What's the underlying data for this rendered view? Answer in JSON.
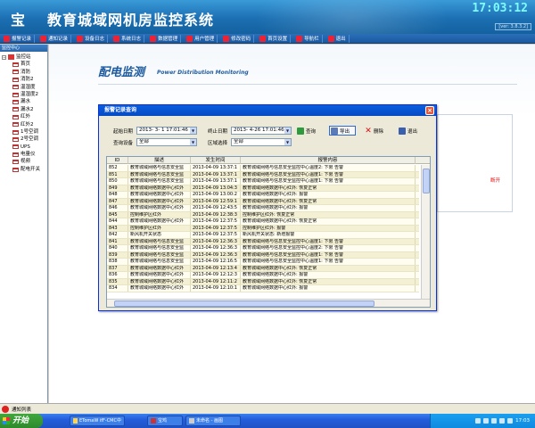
{
  "app": {
    "title_a": "宝",
    "title_b": "教育城域网机房监控系统",
    "clock": "17:03:12",
    "version": "ver: 3.8.3.2"
  },
  "toolbar": [
    {
      "label": "报警记录",
      "icon": "alarm-record-icon"
    },
    {
      "label": "通知记录",
      "icon": "notice-record-icon"
    },
    {
      "label": "设备日志",
      "icon": "device-log-icon"
    },
    {
      "label": "系统日志",
      "icon": "system-log-icon"
    },
    {
      "label": "数据管理",
      "icon": "data-manage-icon"
    },
    {
      "label": "用户管理",
      "icon": "user-manage-icon"
    },
    {
      "label": "修改密码",
      "icon": "password-icon"
    },
    {
      "label": "首页设置",
      "icon": "home-settings-icon"
    },
    {
      "label": "导航栏",
      "icon": "nav-bar-icon"
    },
    {
      "label": "退出",
      "icon": "exit-icon"
    }
  ],
  "sidebar": {
    "header": "监控中心",
    "root": "监控站",
    "items": [
      "首页",
      "消防",
      "消防2",
      "温湿度",
      "温湿度2",
      "漏水",
      "漏水2",
      "红外",
      "红外2",
      "1号空调",
      "2号空调",
      "UPS",
      "电量仪",
      "视频",
      "配电开关"
    ]
  },
  "page": {
    "title": "配电监测",
    "subtitle": "Power Distribution Monitoring",
    "behind_text": "断开"
  },
  "dialog": {
    "title": "报警记录查询",
    "start_label": "起始日期",
    "start_value": "2013- 3- 1  17:01:46",
    "end_label": "终止日期",
    "end_value": "2013- 4-26  17:01:46",
    "device_label": "查询设备",
    "device_value": "全部",
    "area_label": "区域选择",
    "area_value": "全部",
    "buttons": {
      "query": "查询",
      "export": "导出",
      "delete": "删除",
      "exit": "退出"
    },
    "columns": [
      "ID",
      "描述",
      "发生时间",
      "报警内容"
    ],
    "rows": [
      [
        "852",
        "教育城域网络与信息安全监",
        "2013-04-09 13:37:1",
        "教育城域网络与信息安全监控中心温度2: 下限 告警"
      ],
      [
        "851",
        "教育城域网络与信息安全监",
        "2013-04-09 13:37:1",
        "教育城域网络与信息安全监控中心温度1: 下限 告警"
      ],
      [
        "850",
        "教育城域网络与信息安全监",
        "2013-04-09 13:37:1",
        "教育城域网络与信息安全监控中心温度1: 下限 告警"
      ],
      [
        "849",
        "教育城域网络数据中心红外",
        "2013-04-09 13:04:3",
        "教育城域网络数据中心红外: 恢复正常"
      ],
      [
        "848",
        "教育城域网络数据中心红外",
        "2013-04-09 13:00:2",
        "教育城域网络数据中心红外: 报警"
      ],
      [
        "847",
        "教育城域网络数据中心红外",
        "2013-04-09 12:59:1",
        "教育城域网络数据中心红外: 恢复正常"
      ],
      [
        "846",
        "教育城域网络数据中心红外",
        "2013-04-09 12:43:5",
        "教育城域网络数据中心红外: 报警"
      ],
      [
        "845",
        "控制维护区红外",
        "2013-04-09 12:38:3",
        "控制维护区红外: 恢复正常"
      ],
      [
        "844",
        "教育城域网络数据中心红外",
        "2013-04-09 12:37:5",
        "教育城域网络数据中心红外: 恢复正常"
      ],
      [
        "843",
        "控制维护区红外",
        "2013-04-09 12:37:5",
        "控制维护区红外: 报警"
      ],
      [
        "842",
        "新风机开关状态",
        "2013-04-09 12:37:5",
        "新风机开关状态: 新增报警"
      ],
      [
        "841",
        "教育城域网络与信息安全监",
        "2013-04-09 12:36:3",
        "教育城域网络与信息安全监控中心温度1: 下限 告警"
      ],
      [
        "840",
        "教育城域网络与信息安全监",
        "2013-04-09 12:36:3",
        "教育城域网络与信息安全监控中心温度2: 下限 告警"
      ],
      [
        "839",
        "教育城域网络与信息安全监",
        "2013-04-09 12:36:3",
        "教育城域网络与信息安全监控中心温度1: 下限 告警"
      ],
      [
        "838",
        "教育城域网络与信息安全监",
        "2013-04-09 12:16:5",
        "教育城域网络与信息安全监控中心温度1: 下限 告警"
      ],
      [
        "837",
        "教育城域网络数据中心红外",
        "2013-04-09 12:13:4",
        "教育城域网络数据中心红外: 恢复正常"
      ],
      [
        "836",
        "教育城域网络数据中心红外",
        "2013-04-09 12:12:3",
        "教育城域网络数据中心红外: 报警"
      ],
      [
        "835",
        "教育城域网络数据中心红外",
        "2013-04-09 12:11:2",
        "教育城域网络数据中心红外: 恢复正常"
      ],
      [
        "834",
        "教育城域网络数据中心红外",
        "2013-04-09 12:10:1",
        "教育城域网络数据中心红外: 报警"
      ]
    ]
  },
  "status": {
    "text": "通知列表"
  },
  "taskbar": {
    "start": "开始",
    "tasks": [
      "ETomaW ifF-CMC中",
      "宝鸡",
      "未命名 - 画图"
    ],
    "clock": "17:03"
  },
  "colors": {
    "banner": "#1b6fb2",
    "title_blue": "#1e5b9e",
    "alarm_red": "#e00000"
  }
}
